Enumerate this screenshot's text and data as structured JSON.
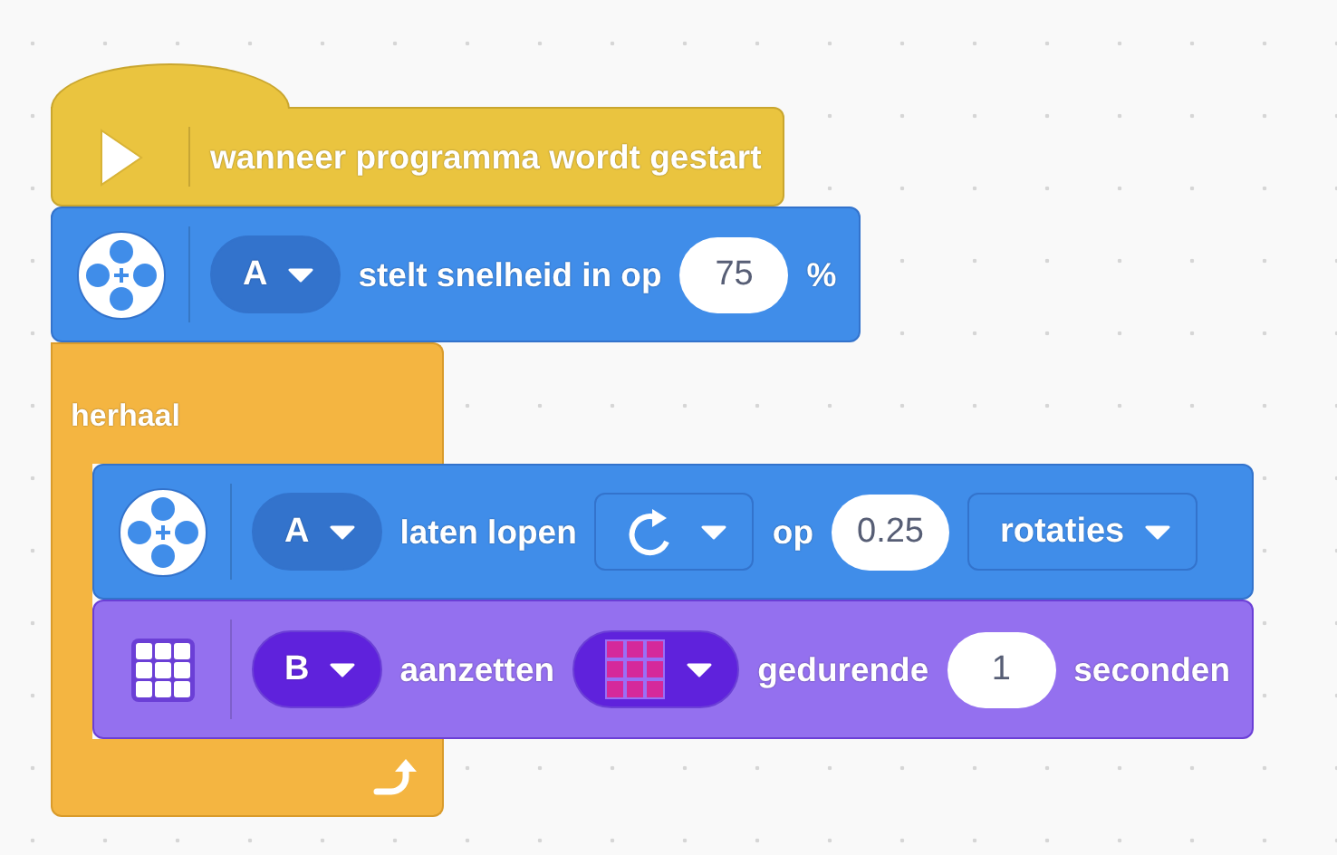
{
  "script": [
    {
      "kind": "hat",
      "parts": [
        {
          "kind": "label",
          "text": "wanneer programma wordt gestart"
        }
      ]
    },
    {
      "kind": "motor",
      "parts": [
        {
          "kind": "port",
          "text": "A"
        },
        {
          "kind": "label",
          "text": "stelt snelheid in op"
        },
        {
          "kind": "number",
          "text": "75"
        },
        {
          "kind": "label",
          "text": "%"
        }
      ]
    },
    {
      "kind": "loop",
      "label": "herhaal",
      "children": [
        {
          "kind": "motor",
          "parts": [
            {
              "kind": "port",
              "text": "A"
            },
            {
              "kind": "label",
              "text": "laten lopen"
            },
            {
              "kind": "direction"
            },
            {
              "kind": "label",
              "text": "op"
            },
            {
              "kind": "number",
              "text": "0.25"
            },
            {
              "kind": "menu",
              "text": "rotaties"
            }
          ]
        },
        {
          "kind": "light",
          "parts": [
            {
              "kind": "port",
              "text": "B"
            },
            {
              "kind": "label",
              "text": "aanzetten"
            },
            {
              "kind": "matrix"
            },
            {
              "kind": "label",
              "text": "gedurende"
            },
            {
              "kind": "number",
              "text": "1"
            },
            {
              "kind": "label",
              "text": "seconden"
            }
          ]
        }
      ]
    }
  ]
}
